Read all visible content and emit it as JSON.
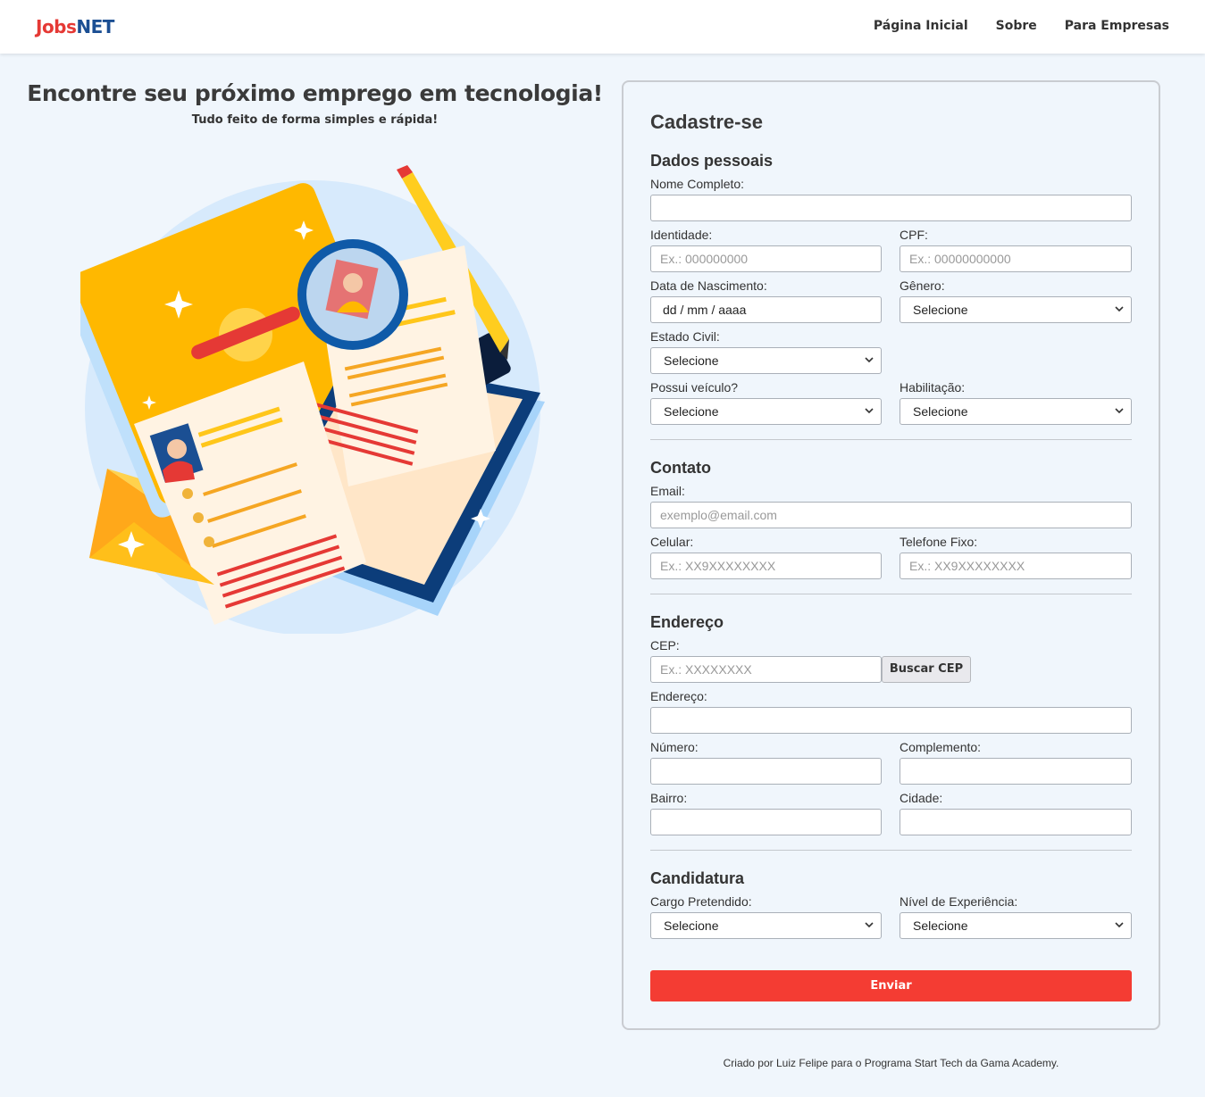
{
  "header": {
    "logo_part1": "Jobs",
    "logo_part2": "NET",
    "nav": [
      "Página Inicial",
      "Sobre",
      "Para Empresas"
    ]
  },
  "hero": {
    "title": "Encontre seu próximo emprego em tecnologia!",
    "subtitle": "Tudo feito de forma simples e rápida!"
  },
  "form": {
    "title": "Cadastre-se",
    "personal": {
      "title": "Dados pessoais",
      "nome_label": "Nome Completo:",
      "identidade_label": "Identidade:",
      "identidade_placeholder": "Ex.: 000000000",
      "cpf_label": "CPF:",
      "cpf_placeholder": "Ex.: 00000000000",
      "nascimento_label": "Data de Nascimento:",
      "nascimento_value": "dd / mm / aaaa",
      "genero_label": "Gênero:",
      "genero_value": "Selecione",
      "estado_civil_label": "Estado Civil:",
      "estado_civil_value": "Selecione",
      "veiculo_label": "Possui veículo?",
      "veiculo_value": "Selecione",
      "habilitacao_label": "Habilitação:",
      "habilitacao_value": "Selecione"
    },
    "contact": {
      "title": "Contato",
      "email_label": "Email:",
      "email_placeholder": "exemplo@email.com",
      "celular_label": "Celular:",
      "celular_placeholder": "Ex.: XX9XXXXXXXX",
      "fixo_label": "Telefone Fixo:",
      "fixo_placeholder": "Ex.: XX9XXXXXXXX"
    },
    "address": {
      "title": "Endereço",
      "cep_label": "CEP:",
      "cep_placeholder": "Ex.: XXXXXXXX",
      "cep_button": "Buscar CEP",
      "endereco_label": "Endereço:",
      "numero_label": "Número:",
      "complemento_label": "Complemento:",
      "bairro_label": "Bairro:",
      "cidade_label": "Cidade:"
    },
    "application": {
      "title": "Candidatura",
      "cargo_label": "Cargo Pretendido:",
      "cargo_value": "Selecione",
      "nivel_label": "Nível de Experiência:",
      "nivel_value": "Selecione"
    },
    "submit": "Enviar"
  },
  "footer": {
    "text": "Criado por Luiz Felipe para o Programa Start Tech da Gama Academy."
  },
  "colors": {
    "brand_red": "#e53935",
    "brand_blue": "#1b4f93",
    "submit": "#f43c33",
    "background": "#f0f6fc"
  }
}
